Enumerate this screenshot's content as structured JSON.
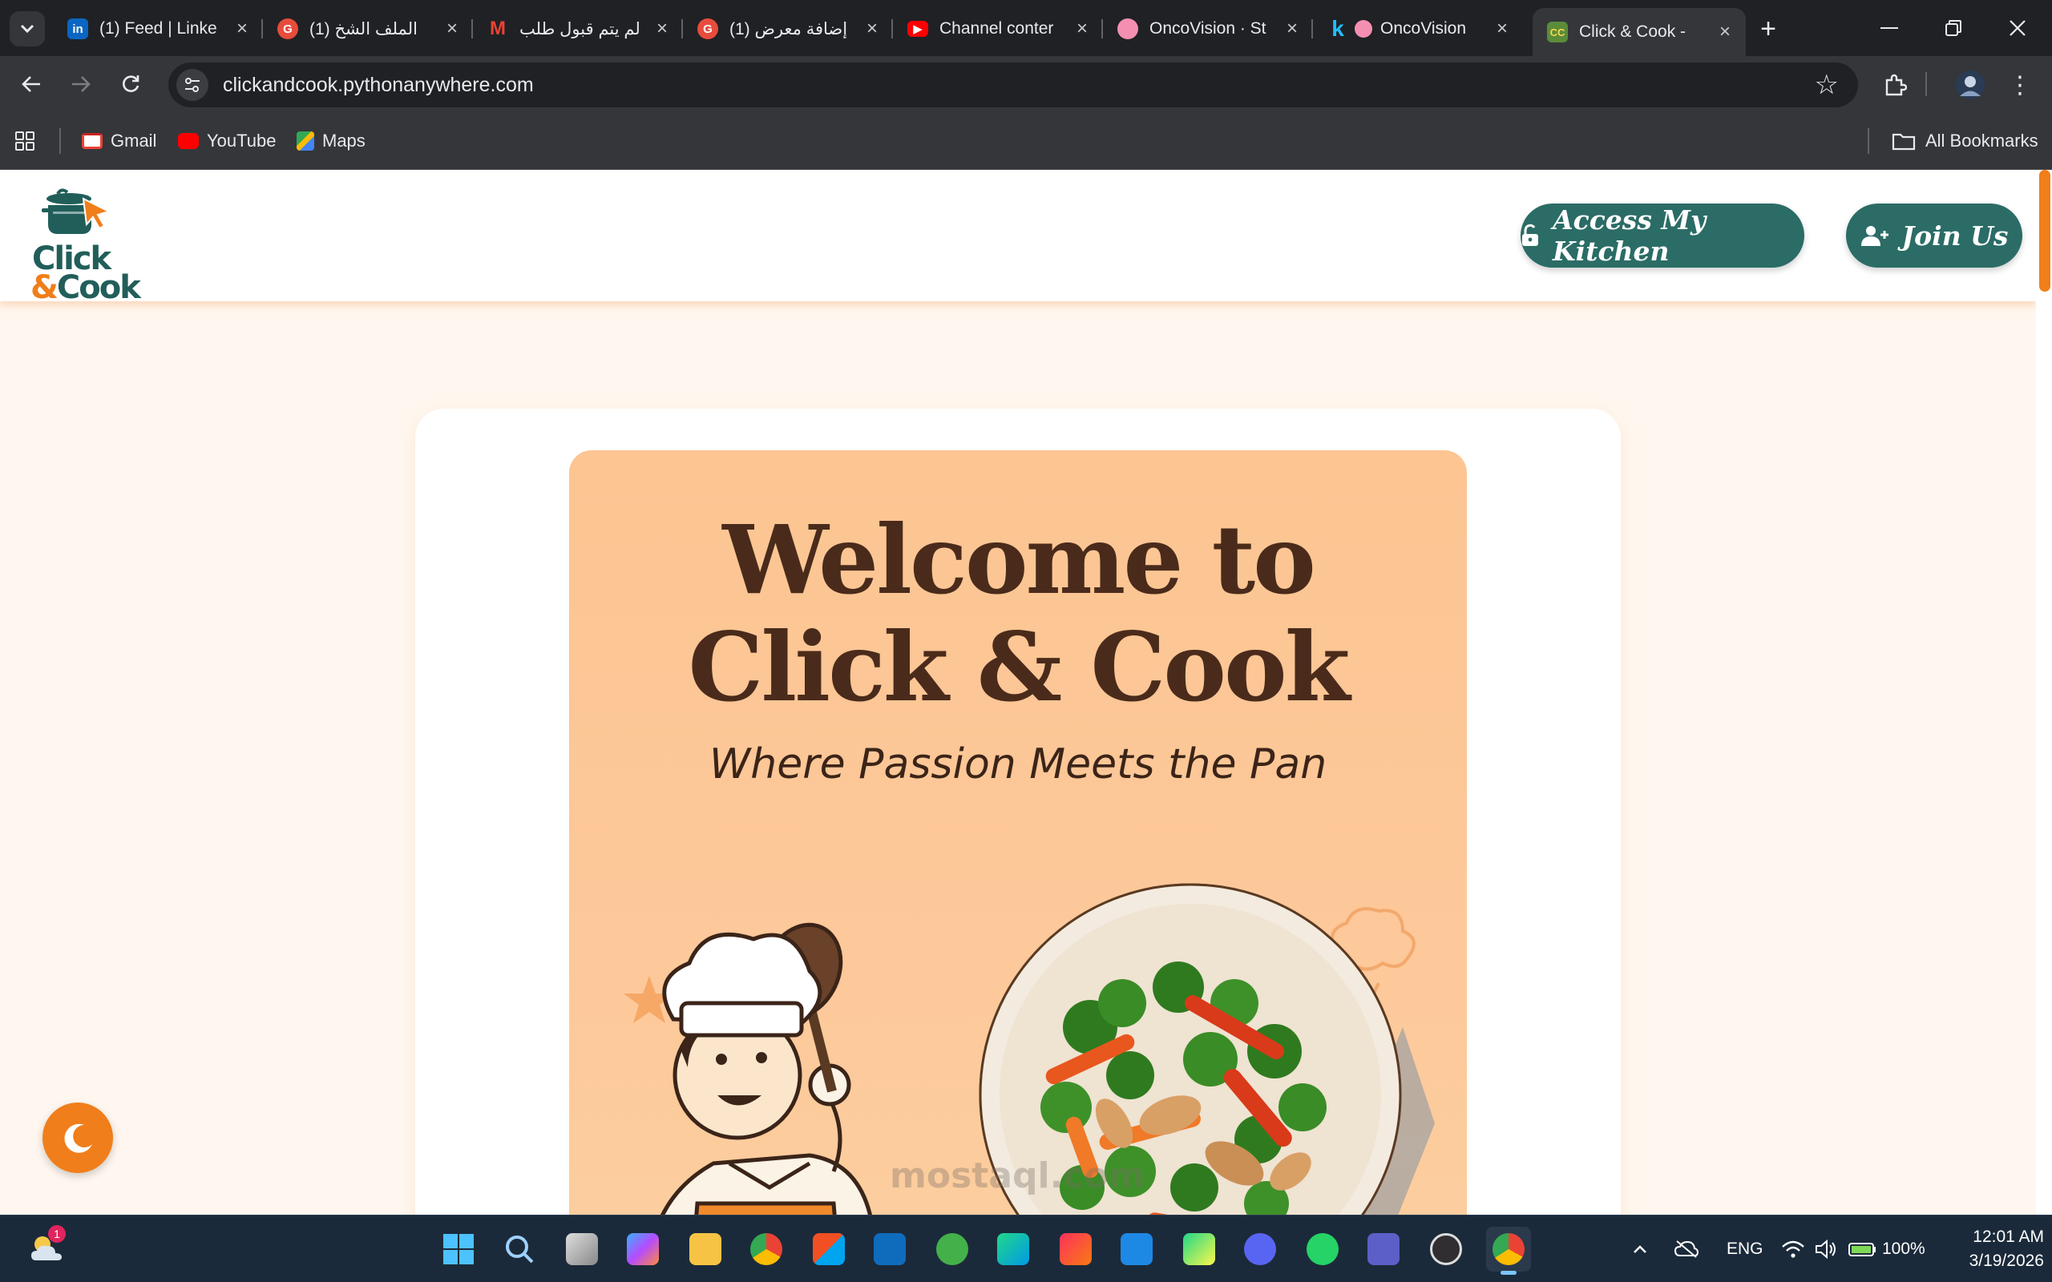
{
  "browser": {
    "tabs": [
      {
        "title": "(1) Feed | Linke",
        "favicon": "linkedin-icon",
        "color": "#0a66c2"
      },
      {
        "title": "(1) الملف الشخ",
        "favicon": "grammarly-icon",
        "color": "#e74c3c"
      },
      {
        "title": "لم يتم قبول طلب",
        "favicon": "gmail-icon",
        "color": "#ea4335"
      },
      {
        "title": "(1) إضافة معرض",
        "favicon": "grammarly-icon",
        "color": "#e74c3c"
      },
      {
        "title": "Channel conter",
        "favicon": "youtube-icon",
        "color": "#ff0000"
      },
      {
        "title": "OncoVision · St",
        "favicon": "brain-icon",
        "color": "#f48fb1"
      },
      {
        "title": "OncoVision",
        "favicon": "brain-icon",
        "color": "#f48fb1"
      },
      {
        "title": "Click & Cook -",
        "favicon": "clickcook-icon",
        "color": "#5b8c3a"
      }
    ],
    "url": "clickandcook.pythonanywhere.com",
    "bookmarks": [
      {
        "label": "Gmail",
        "icon": "gmail-icon"
      },
      {
        "label": "YouTube",
        "icon": "youtube-icon"
      },
      {
        "label": "Maps",
        "icon": "maps-icon"
      }
    ],
    "all_bookmarks": "All Bookmarks"
  },
  "site": {
    "logo": {
      "line1": "Click",
      "line2_amp": "&",
      "line2": "Cook"
    },
    "buttons": {
      "access": "Access My Kitchen",
      "join": "Join Us"
    },
    "hero": {
      "title_line1": "Welcome to",
      "title_line2": "Click & Cook",
      "subtitle": "Where Passion Meets the Pan"
    },
    "watermark": "mostaql.com",
    "colors": {
      "primary": "#2b6c66",
      "accent": "#f07e1a",
      "background": "#fff7ef"
    }
  },
  "taskbar": {
    "weather_badge": "1",
    "language": "ENG",
    "battery": "100%",
    "time": "12:01 AM",
    "date": "3/19/2026"
  }
}
